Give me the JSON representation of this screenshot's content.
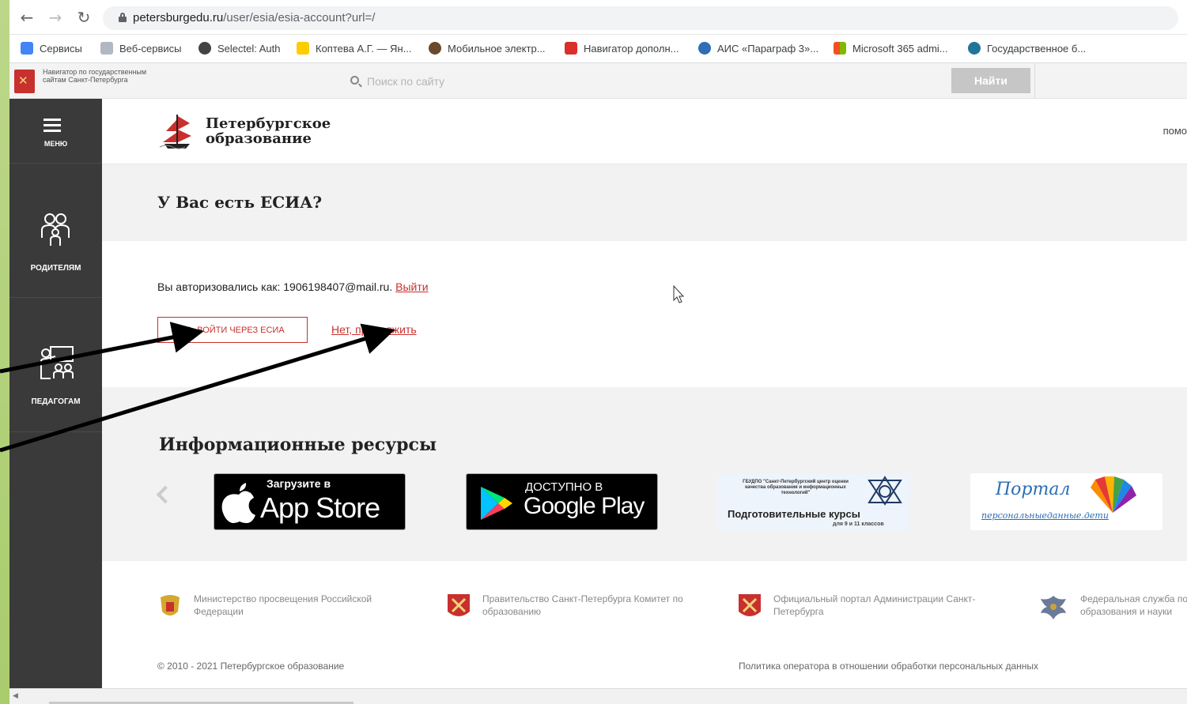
{
  "browser": {
    "url_host": "petersburgedu.ru",
    "url_path": "/user/esia/esia-account?url=/",
    "bookmarks": [
      {
        "label": "Сервисы",
        "color": "#4285f4"
      },
      {
        "label": "Веб-сервисы",
        "color": "#b0b8c4"
      },
      {
        "label": "Selectel: Auth",
        "color": "#444444"
      },
      {
        "label": "Коптева А.Г. — Ян...",
        "color": "#ffcc00"
      },
      {
        "label": "Мобильное электр...",
        "color": "#6a4a2a"
      },
      {
        "label": "Навигатор дополн...",
        "color": "#d9302b"
      },
      {
        "label": "АИС «Параграф 3»...",
        "color": "#2f6db5"
      },
      {
        "label": "Microsoft 365 admi...",
        "color": "#f25022"
      },
      {
        "label": "Государственное б...",
        "color": "#21759b"
      }
    ]
  },
  "navigator": {
    "logo_text": "Навигатор по государственным сайтам Санкт-Петербурга",
    "search_placeholder": "Поиск по сайту",
    "search_button": "Найти"
  },
  "sidebar": {
    "menu_label": "МЕНЮ",
    "items": [
      {
        "label": "РОДИТЕЛЯМ",
        "icon": "parents-icon"
      },
      {
        "label": "ПЕДАГОГАМ",
        "icon": "teachers-icon"
      }
    ]
  },
  "site": {
    "logo_line1": "Петербургское",
    "logo_line2": "образование",
    "help_link": "помо"
  },
  "esia": {
    "title": "У Вас есть ЕСИА?",
    "auth_prefix": "Вы авторизовались как: 1906198407@mail.ru.",
    "logout_link": "Выйти",
    "login_button": "ДА, ВОЙТИ ЧЕРЕЗ ЕСИА",
    "skip_link": "Нет, продолжить"
  },
  "resources": {
    "title": "Информационные ресурсы",
    "appstore_small": "Загрузите в",
    "appstore_big": "App Store",
    "googleplay_small": "ДОСТУПНО В",
    "googleplay_big": "Google Play",
    "kursy_header": "ГБУДПО \"Санкт-Петербургский центр оценки качества образования и информационных технологий\"",
    "kursy_title": "Подготовительные курсы",
    "kursy_sub": "для 9 и 11 классов",
    "portal_title": "Портал",
    "portal_sub": "персональныеданные.дети"
  },
  "footer": {
    "items": [
      {
        "text": "Министерство просвещения Российской Федерации",
        "icon": "emblem-russia-icon"
      },
      {
        "text": "Правительство Санкт-Петербурга Комитет по образованию",
        "icon": "spb-coat-icon"
      },
      {
        "text": "Официальный портал Администрации Санкт-Петербурга",
        "icon": "spb-coat-icon"
      },
      {
        "text": "Федеральная служба по н образования и науки",
        "icon": "eagle-icon"
      }
    ],
    "copyright": "© 2010 - 2021 Петербургское образование",
    "policy": "Политика оператора в отношении обработки персональных данных"
  },
  "colors": {
    "accent": "#c8302e",
    "sidebar": "#3a3a3a",
    "slide_background": "#a9cc6d"
  }
}
